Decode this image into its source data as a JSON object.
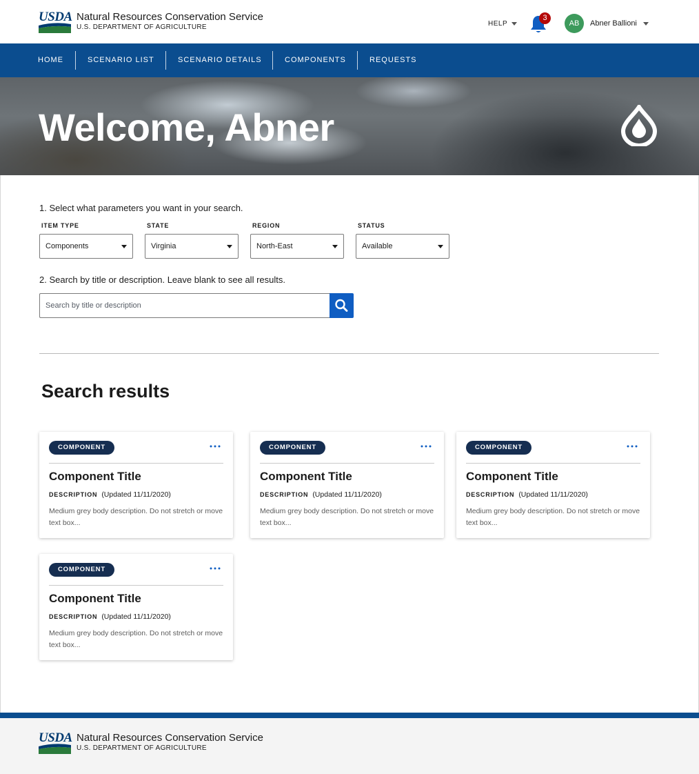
{
  "header": {
    "logo_text": "USDA",
    "org_name": "Natural Resources Conservation Service",
    "org_sub": "U.S. DEPARTMENT OF AGRICULTURE",
    "help_label": "HELP",
    "notification_count": "3",
    "user_initials": "AB",
    "user_name": "Abner Ballioni"
  },
  "nav": {
    "items": [
      "HOME",
      "SCENARIO LIST",
      "SCENARIO DETAILS",
      "COMPONENTS",
      "REQUESTS"
    ]
  },
  "hero": {
    "title": "Welcome, Abner"
  },
  "search": {
    "step1": "1. Select what parameters you want in your search.",
    "filters": [
      {
        "label": "ITEM TYPE",
        "value": "Components"
      },
      {
        "label": "STATE",
        "value": "Virginia"
      },
      {
        "label": "REGION",
        "value": "North-East"
      },
      {
        "label": "STATUS",
        "value": "Available"
      }
    ],
    "step2": "2. Search by title or description. Leave blank to see all results.",
    "placeholder": "Search by title or description"
  },
  "results": {
    "title": "Search results",
    "cards": [
      {
        "badge": "COMPONENT",
        "title": "Component Title",
        "meta_label": "DESCRIPTION",
        "meta_date": "(Updated 11/11/2020)",
        "body": "Medium grey body description. Do not stretch or move text box..."
      },
      {
        "badge": "COMPONENT",
        "title": "Component Title",
        "meta_label": "DESCRIPTION",
        "meta_date": "(Updated 11/11/2020)",
        "body": "Medium grey body description. Do not stretch or move text box..."
      },
      {
        "badge": "COMPONENT",
        "title": "Component Title",
        "meta_label": "DESCRIPTION",
        "meta_date": "(Updated 11/11/2020)",
        "body": "Medium grey body description. Do not stretch or move text box..."
      },
      {
        "badge": "COMPONENT",
        "title": "Component Title",
        "meta_label": "DESCRIPTION",
        "meta_date": "(Updated 11/11/2020)",
        "body": "Medium grey body description. Do not stretch or move text box..."
      }
    ]
  },
  "footer": {
    "logo_text": "USDA",
    "org_name": "Natural Resources Conservation Service",
    "org_sub": "U.S. DEPARTMENT OF AGRICULTURE"
  },
  "colors": {
    "nav_blue": "#0b4d8f",
    "badge_navy": "#162e51",
    "search_blue": "#0f5dc2",
    "avatar_green": "#3d9a5c",
    "alert_red": "#b50909",
    "bell_blue": "#0f5dc2"
  },
  "icons": [
    "usda-logo",
    "caret-down-icon",
    "bell-icon",
    "water-drop-icon",
    "search-icon",
    "more-icon"
  ]
}
